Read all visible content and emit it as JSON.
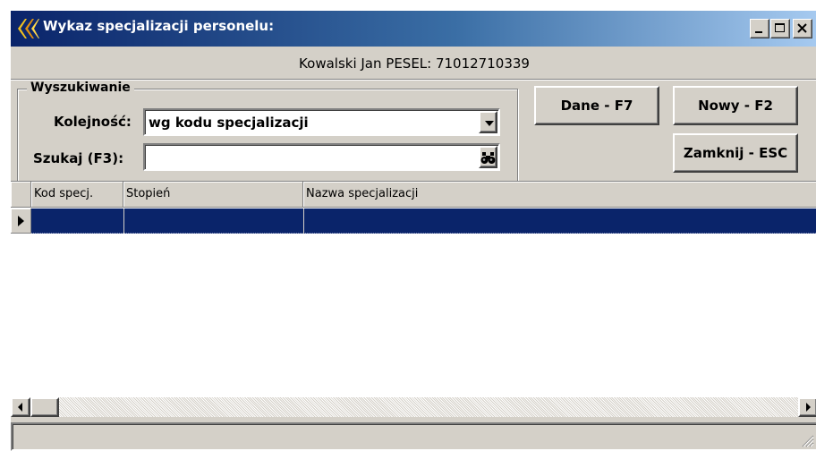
{
  "window": {
    "title": "Wykaz specjalizacji personelu:",
    "minimize_symbol": "_",
    "maximize_symbol": "□",
    "close_symbol": "×"
  },
  "person": {
    "info": "Kowalski Jan  PESEL: 71012710339"
  },
  "search_group": {
    "title": "Wyszukiwanie",
    "order_label": "Kolejność:",
    "order_value": "wg kodu specjalizacji",
    "search_label": "Szukaj (F3):",
    "search_value": ""
  },
  "buttons": {
    "details": "Dane - F7",
    "new": "Nowy - F2",
    "close": "Zamknij - ESC"
  },
  "grid": {
    "columns": [
      "Kod specj.",
      "Stopień",
      "Nazwa specjalizacji"
    ],
    "rows": [
      {
        "code": "",
        "degree": "",
        "name": ""
      }
    ]
  },
  "colors": {
    "titlebar_start": "#0a246a",
    "titlebar_end": "#a6caf0",
    "selection": "#0a246a",
    "face": "#d4d0c8"
  },
  "icons": {
    "app": "app-icon",
    "search": "binoculars-icon",
    "combo": "chevron-down-icon",
    "row": "row-pointer-icon",
    "grip": "resize-grip-icon"
  }
}
